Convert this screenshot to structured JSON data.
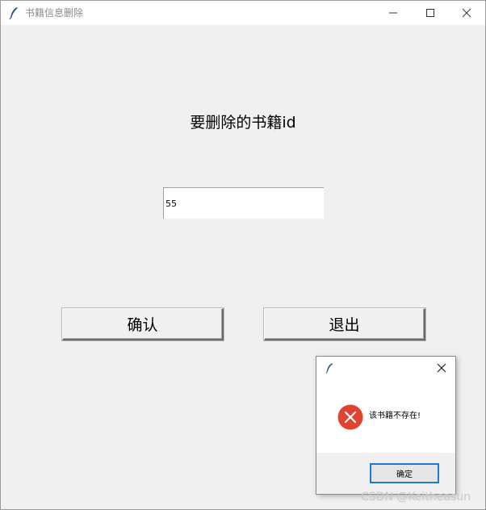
{
  "window": {
    "title": "书籍信息删除"
  },
  "form": {
    "heading": "要删除的书籍id",
    "id_value": "55",
    "confirm_label": "确认",
    "exit_label": "退出"
  },
  "dialog": {
    "message": "该书籍不存在!",
    "ok_label": "确定",
    "icon": "error-icon"
  },
  "watermark": "CSDN @Keitheasun",
  "colors": {
    "error_red": "#e0432f",
    "focus_blue": "#1f7ad3",
    "feather": "#2a4a8a"
  }
}
